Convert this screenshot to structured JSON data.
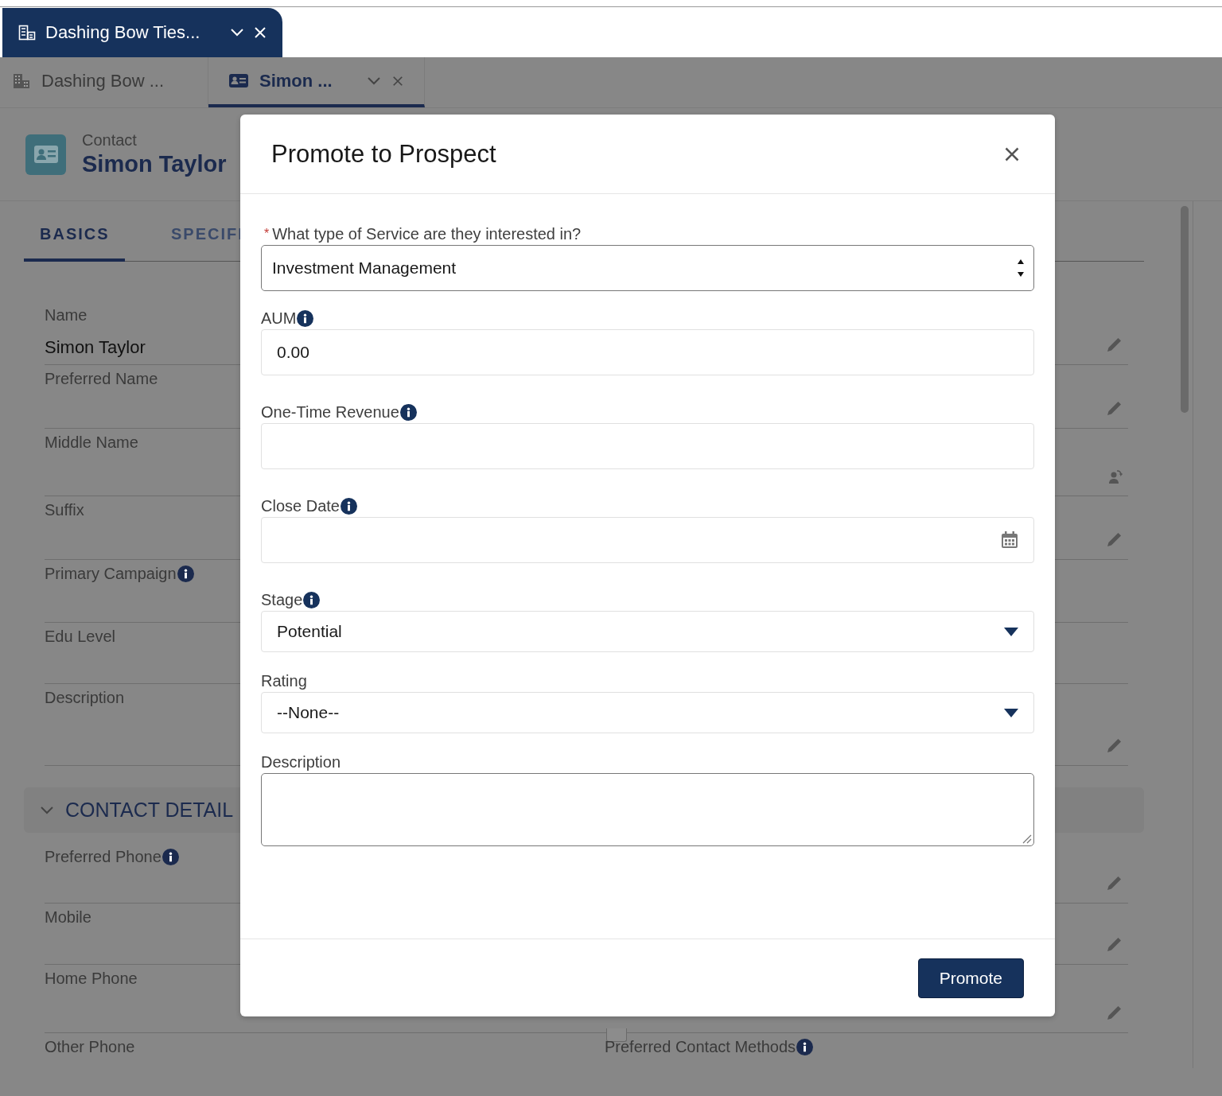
{
  "workspace_tab": {
    "label": "Dashing Bow Ties...",
    "selected": true
  },
  "subtabs": [
    {
      "kind": "account",
      "label": "Dashing Bow ...",
      "selected": false
    },
    {
      "kind": "contact",
      "label": "Simon ...",
      "selected": true
    }
  ],
  "record": {
    "type": "Contact",
    "name": "Simon Taylor"
  },
  "record_tabs": [
    {
      "label": "BASICS",
      "selected": true
    },
    {
      "label": "SPECIFI",
      "selected": false
    }
  ],
  "fields": [
    {
      "kind": "editable",
      "label": "Name",
      "value": "Simon Taylor",
      "info": false
    },
    {
      "kind": "editable",
      "label": "Preferred Name",
      "info": false
    },
    {
      "kind": "owner",
      "label": "Middle Name",
      "info": false
    },
    {
      "kind": "editable",
      "label": "Suffix",
      "info": false
    },
    {
      "kind": "readonly",
      "label": "Primary Campaign",
      "info": true
    },
    {
      "kind": "readonly",
      "label": "Edu Level",
      "info": false
    },
    {
      "kind": "editable",
      "label": "Description",
      "info": false
    }
  ],
  "section": {
    "title": "CONTACT DETAIL",
    "expanded": true
  },
  "section_fields": [
    {
      "kind": "editable",
      "label": "Preferred Phone",
      "info": true
    },
    {
      "kind": "editable",
      "label": "Mobile",
      "info": false
    },
    {
      "kind": "editable",
      "label": "Home Phone",
      "info": false,
      "checkbox": {
        "checked": false
      }
    }
  ],
  "last_row": [
    {
      "label": "Other Phone",
      "info": false
    },
    {
      "label": "Preferred Contact Methods",
      "info": true
    }
  ],
  "modal": {
    "title": "Promote to Prospect",
    "fields": [
      {
        "kind": "select",
        "required_mark": "*",
        "label": "What type of Service are they interested in?",
        "info": false,
        "value": "Investment Management"
      },
      {
        "kind": "text",
        "label": "AUM",
        "info": true,
        "value": "0.00"
      },
      {
        "kind": "text",
        "label": "One-Time Revenue",
        "info": true
      },
      {
        "kind": "date",
        "label": "Close Date",
        "info": true
      },
      {
        "kind": "combobox",
        "label": "Stage",
        "info": true,
        "value": "Potential"
      },
      {
        "kind": "combobox",
        "label": "Rating",
        "info": false,
        "value": "--None--"
      },
      {
        "kind": "textarea",
        "label": "Description",
        "info": false
      }
    ],
    "button": "Promote"
  }
}
